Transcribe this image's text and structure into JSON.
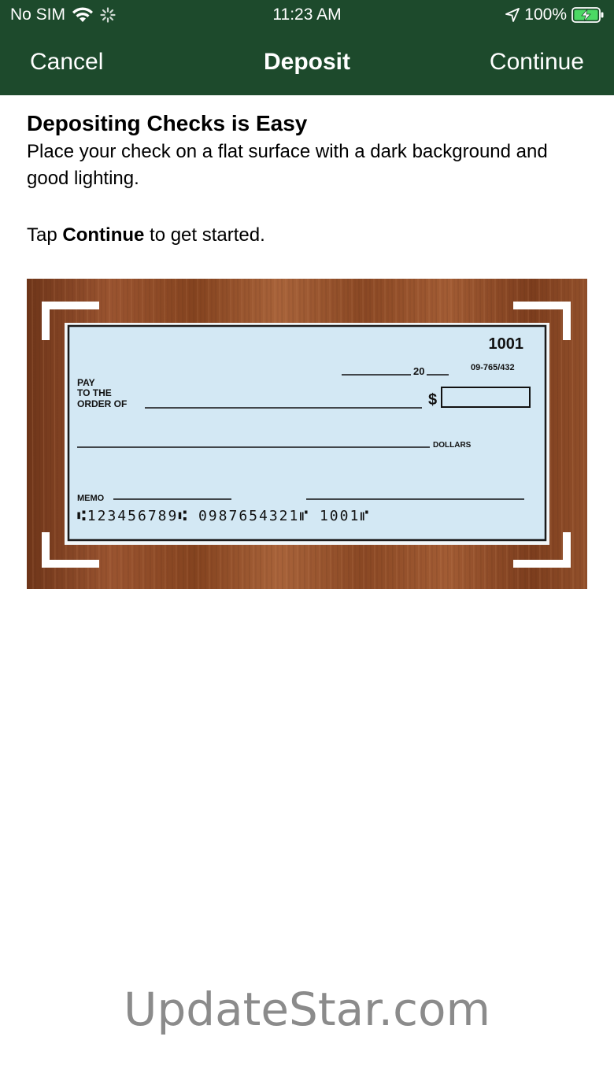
{
  "status_bar": {
    "carrier": "No SIM",
    "time": "11:23 AM",
    "battery": "100%",
    "icons": [
      "wifi-icon",
      "activity-spinner-icon",
      "location-arrow-icon",
      "battery-charging-icon"
    ]
  },
  "nav": {
    "cancel_label": "Cancel",
    "title": "Deposit",
    "continue_label": "Continue"
  },
  "instructions": {
    "heading": "Depositing Checks is Easy",
    "description": "Place your check on a flat surface with a dark background and good lighting.",
    "tap_prefix": "Tap ",
    "tap_bold": "Continue",
    "tap_suffix": " to get started."
  },
  "check": {
    "number": "1001",
    "date_suffix": "20",
    "routing_fraction": "09-765/432",
    "pay_line1": "PAY",
    "pay_line2": "TO THE",
    "pay_line3": "ORDER OF",
    "dollar_sign": "$",
    "dollars_label": "DOLLARS",
    "memo_label": "MEMO",
    "micr": "⑆123456789⑆  0987654321⑈  1001⑈"
  },
  "watermark": "UpdateStar.com",
  "colors": {
    "header_bg": "#1d4a2c",
    "check_bg": "#d3e8f4",
    "wood": "#8e4a24",
    "battery_green": "#4cd964"
  }
}
